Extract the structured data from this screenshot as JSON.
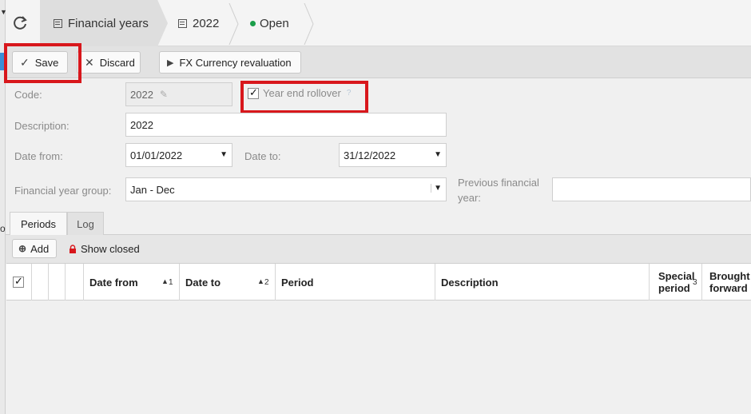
{
  "breadcrumb": {
    "items": [
      {
        "label": "Financial years",
        "icon": "calendar-icon"
      },
      {
        "label": "2022",
        "icon": "calendar-icon"
      },
      {
        "label": "Open",
        "icon": "status-dot-icon",
        "color": "#1a9e4a"
      }
    ]
  },
  "toolbar": {
    "save_label": "Save",
    "discard_label": "Discard",
    "fx_label": "FX Currency revaluation"
  },
  "form": {
    "code_label": "Code:",
    "code_value": "2022",
    "year_end_rollover_label": "Year end rollover",
    "year_end_rollover_checked": true,
    "help_mark": "?",
    "description_label": "Description:",
    "description_value": "2022",
    "date_from_label": "Date from:",
    "date_from_value": "01/01/2022",
    "date_to_label": "Date to:",
    "date_to_value": "31/12/2022",
    "fy_group_label": "Financial year group:",
    "fy_group_value": "Jan - Dec",
    "prev_fy_label_1": "Previous financial",
    "prev_fy_label_2": "year:",
    "prev_fy_value": ""
  },
  "tabs": [
    {
      "label": "Periods",
      "active": true
    },
    {
      "label": "Log",
      "active": false
    }
  ],
  "periods": {
    "add_label": "Add",
    "show_closed_label": "Show closed",
    "columns": {
      "date_from": "Date from",
      "date_from_sort": "1",
      "date_to": "Date to",
      "date_to_sort": "2",
      "period": "Period",
      "description": "Description",
      "special_1": "Special",
      "special_2": "period",
      "special_sort": "3",
      "brought_1": "Brought",
      "brought_2": "forward"
    }
  },
  "colors": {
    "highlight": "#d8171c",
    "accent": "#3b8fd6",
    "lock": "#d8171c"
  }
}
